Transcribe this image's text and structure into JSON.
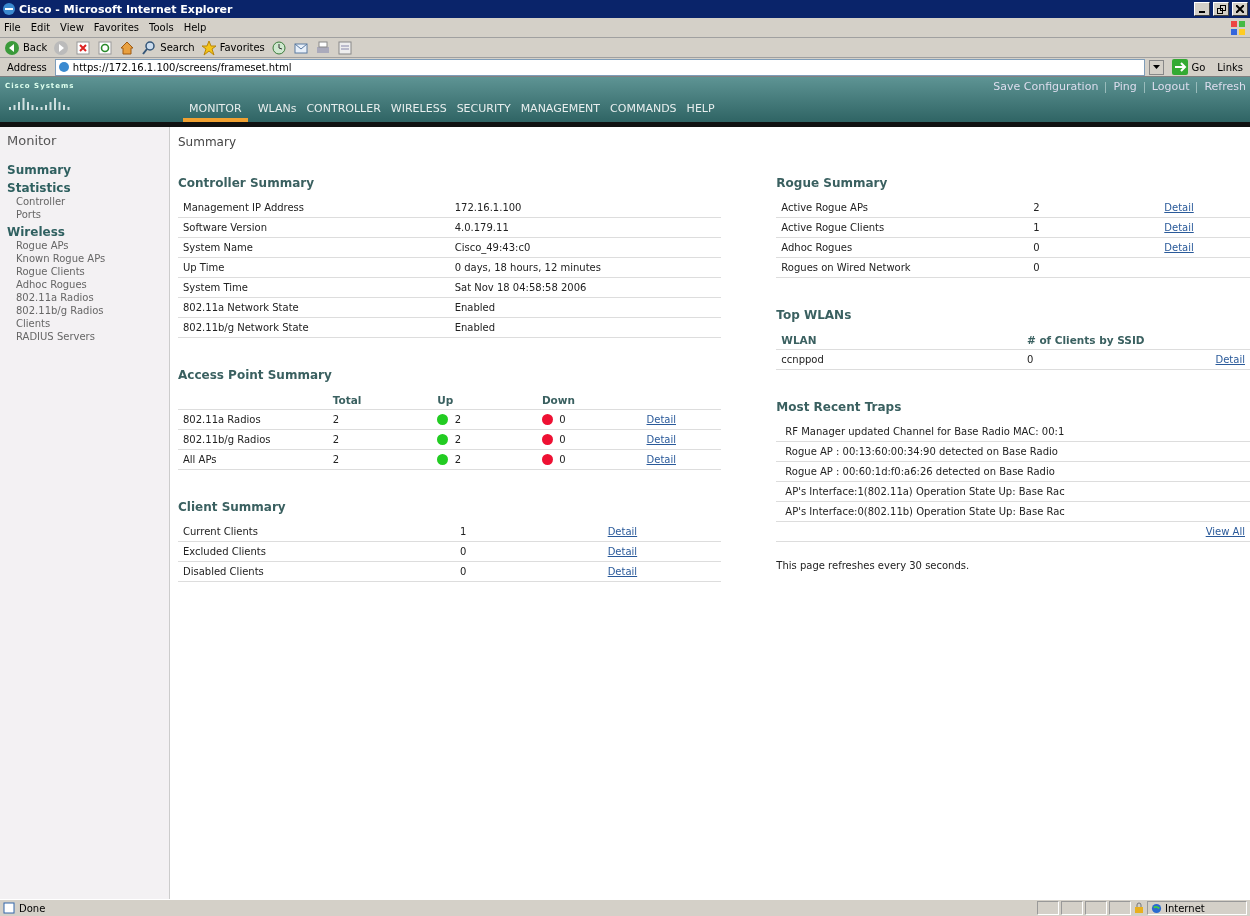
{
  "window": {
    "title": "Cisco - Microsoft Internet Explorer"
  },
  "menu": [
    "File",
    "Edit",
    "View",
    "Favorites",
    "Tools",
    "Help"
  ],
  "toolbar": [
    {
      "kind": "back",
      "label": "Back"
    },
    {
      "kind": "forward"
    },
    {
      "kind": "stop"
    },
    {
      "kind": "refresh"
    },
    {
      "kind": "home"
    },
    {
      "kind": "search",
      "label": "Search"
    },
    {
      "kind": "favorites",
      "label": "Favorites"
    },
    {
      "kind": "history"
    },
    {
      "kind": "mail"
    },
    {
      "kind": "print"
    },
    {
      "kind": "edit"
    }
  ],
  "address": {
    "label": "Address",
    "value": "https://172.16.1.100/screens/frameset.html",
    "go": "Go",
    "links": "Links"
  },
  "header": {
    "logo": "Cisco Systems",
    "links": [
      "Save Configuration",
      "Ping",
      "Logout",
      "Refresh"
    ],
    "tabs": [
      {
        "label": "MONITOR",
        "selected": true
      },
      {
        "label": "WLANs",
        "selected": false
      },
      {
        "label": "CONTROLLER",
        "selected": false
      },
      {
        "label": "WIRELESS",
        "selected": false
      },
      {
        "label": "SECURITY",
        "selected": false
      },
      {
        "label": "MANAGEMENT",
        "selected": false
      },
      {
        "label": "COMMANDS",
        "selected": false
      },
      {
        "label": "HELP",
        "selected": false
      }
    ]
  },
  "sidebar": {
    "title": "Monitor",
    "sections": [
      {
        "label": "Summary"
      },
      {
        "label": "Statistics",
        "items": [
          "Controller",
          "Ports"
        ]
      },
      {
        "label": "Wireless",
        "items": [
          "Rogue APs",
          "Known Rogue APs",
          "Rogue Clients",
          "Adhoc Rogues",
          "802.11a Radios",
          "802.11b/g Radios",
          "Clients",
          "RADIUS Servers"
        ]
      }
    ]
  },
  "page_title": "Summary",
  "controller_summary": {
    "title": "Controller Summary",
    "rows": [
      {
        "label": "Management IP Address",
        "value": "172.16.1.100"
      },
      {
        "label": "Software Version",
        "value": "4.0.179.11"
      },
      {
        "label": "System Name",
        "value": "Cisco_49:43:c0"
      },
      {
        "label": "Up Time",
        "value": "0 days, 18 hours, 12 minutes"
      },
      {
        "label": "System Time",
        "value": "Sat Nov 18 04:58:58 2006"
      },
      {
        "label": "802.11a Network State",
        "value": "Enabled"
      },
      {
        "label": "802.11b/g Network State",
        "value": "Enabled"
      }
    ]
  },
  "ap_summary": {
    "title": "Access Point Summary",
    "columns": [
      "Total",
      "Up",
      "Down"
    ],
    "rows": [
      {
        "label": "802.11a Radios",
        "total": "2",
        "up": "2",
        "down": "0",
        "link": "Detail"
      },
      {
        "label": "802.11b/g Radios",
        "total": "2",
        "up": "2",
        "down": "0",
        "link": "Detail"
      },
      {
        "label": "All APs",
        "total": "2",
        "up": "2",
        "down": "0",
        "link": "Detail"
      }
    ]
  },
  "client_summary": {
    "title": "Client Summary",
    "rows": [
      {
        "label": "Current Clients",
        "value": "1",
        "link": "Detail"
      },
      {
        "label": "Excluded Clients",
        "value": "0",
        "link": "Detail"
      },
      {
        "label": "Disabled Clients",
        "value": "0",
        "link": "Detail"
      }
    ]
  },
  "rogue_summary": {
    "title": "Rogue Summary",
    "rows": [
      {
        "label": "Active Rogue APs",
        "value": "2",
        "link": "Detail"
      },
      {
        "label": "Active Rogue Clients",
        "value": "1",
        "link": "Detail"
      },
      {
        "label": "Adhoc Rogues",
        "value": "0",
        "link": "Detail"
      },
      {
        "label": "Rogues on Wired Network",
        "value": "0"
      }
    ]
  },
  "top_wlans": {
    "title": "Top WLANs",
    "columns": [
      "WLAN",
      "# of Clients by SSID"
    ],
    "rows": [
      {
        "wlan": "ccnppod",
        "clients": "0",
        "link": "Detail"
      }
    ]
  },
  "traps": {
    "title": "Most Recent Traps",
    "items": [
      "RF Manager updated Channel for Base Radio MAC: 00:1",
      "Rogue AP : 00:13:60:00:34:90 detected on Base Radio",
      "Rogue AP : 00:60:1d:f0:a6:26 detected on Base Radio",
      "AP's Interface:1(802.11a) Operation State Up: Base Rac",
      "AP's Interface:0(802.11b) Operation State Up: Base Rac"
    ],
    "view_all": "View All"
  },
  "refresh_note": "This page refreshes every 30 seconds.",
  "status_bar": {
    "text": "Done",
    "zone": "Internet"
  }
}
